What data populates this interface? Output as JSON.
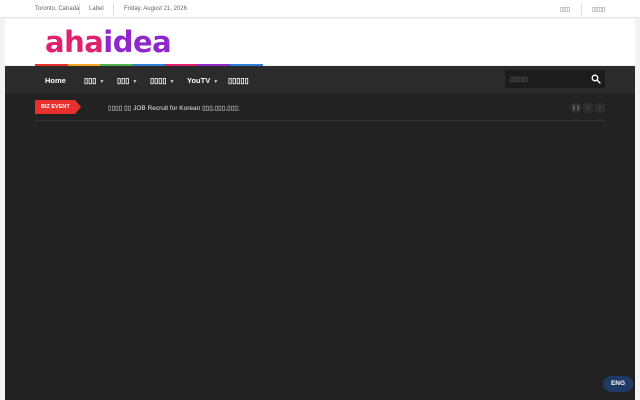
{
  "topbar": {
    "location": "Toronto, Canada",
    "label": "Label",
    "date": "Friday, August 21, 2026",
    "link_left": "▯▯▯",
    "link_right": "▯▯▯▯"
  },
  "brand": {
    "logo_part_1": "aha",
    "logo_part_2": "idea",
    "colors": {
      "aha": "#e0216e",
      "idea": "#8f27c9",
      "stripes": [
        "#e8302f",
        "#f5a623",
        "#4cae4c",
        "#2f7fd6",
        "#e0216e",
        "#8f27c9",
        "#2f7fd6"
      ]
    }
  },
  "nav": {
    "items": [
      {
        "label": "Home",
        "caret": false
      },
      {
        "label": "▯▯▯",
        "caret": true
      },
      {
        "label": "▯▯▯",
        "caret": true
      },
      {
        "label": "▯▯▯▯",
        "caret": true
      },
      {
        "label": "YouTV",
        "caret": true
      },
      {
        "label": "▯▯▯▯▯",
        "caret": false
      }
    ],
    "search_placeholder": "▯▯▯▯▯",
    "search_icon": "search-icon"
  },
  "ticker": {
    "badge": "BIZ EVENT",
    "text": "▯▯▯▯ ▯▯ JOB Recruit for Korean ▯▯▯,▯▯▯,▯▯▯;",
    "controls": [
      "pause-icon",
      "prev-icon",
      "next-icon"
    ]
  },
  "language_button": "ENG"
}
